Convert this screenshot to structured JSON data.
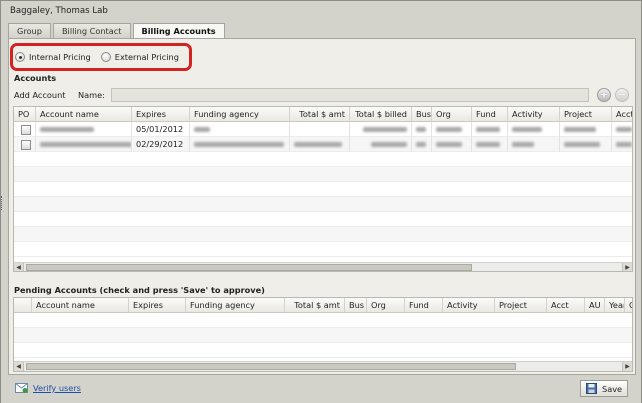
{
  "window": {
    "title": "Baggaley, Thomas Lab"
  },
  "tabs": [
    {
      "label": "Group"
    },
    {
      "label": "Billing Contact"
    },
    {
      "label": "Billing Accounts"
    }
  ],
  "pricing": {
    "internal_label": "Internal Pricing",
    "external_label": "External Pricing",
    "selected": "Internal Pricing",
    "highlight_color": "#d32222"
  },
  "accounts": {
    "section_title": "Accounts",
    "add_label": "Add Account",
    "name_label": "Name:",
    "name_value": "",
    "add_button_icon": "plus-circle-icon",
    "remove_button_icon": "minus-circle-icon",
    "columns": [
      "PO",
      "Account name",
      "Expires",
      "Funding agency",
      "Total $ amt",
      "Total $ billed",
      "Bus",
      "Org",
      "Fund",
      "Activity",
      "Project",
      "Acct"
    ],
    "rows": [
      {
        "expires": "05/01/2012"
      },
      {
        "expires": "02/29/2012"
      }
    ]
  },
  "pending": {
    "section_title": "Pending Accounts (check and press 'Save' to approve)",
    "columns": [
      "Account name",
      "Expires",
      "Funding agency",
      "Total $ amt",
      "Bus",
      "Org",
      "Fund",
      "Activity",
      "Project",
      "Acct",
      "AU",
      "Year",
      "C"
    ]
  },
  "footer": {
    "verify_label": "Verify users",
    "verify_icon": "envelope-check-icon",
    "save_label": "Save",
    "save_icon": "floppy-disk-icon"
  },
  "colors": {
    "link": "#1d4fa5",
    "window_bg": "#d4d3cb",
    "panel_bg": "#efeee8"
  }
}
